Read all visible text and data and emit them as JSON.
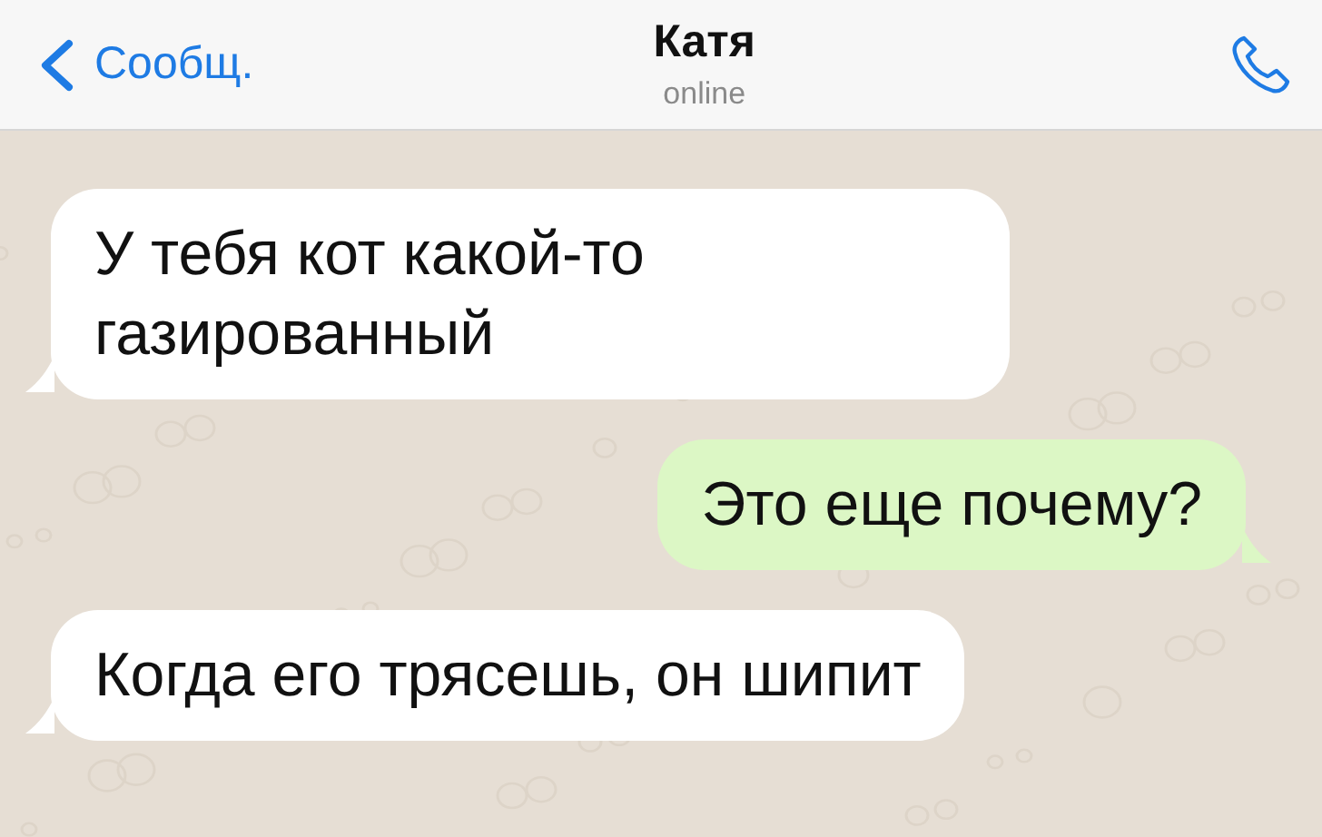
{
  "header": {
    "back_label": "Сообщ.",
    "title": "Катя",
    "status": "online"
  },
  "messages": [
    {
      "kind": "incoming",
      "text": "У тебя кот какой-то газированный"
    },
    {
      "kind": "outgoing",
      "text": "Это еще почему?"
    },
    {
      "kind": "incoming",
      "text": "Когда его трясешь, он шипит"
    }
  ]
}
